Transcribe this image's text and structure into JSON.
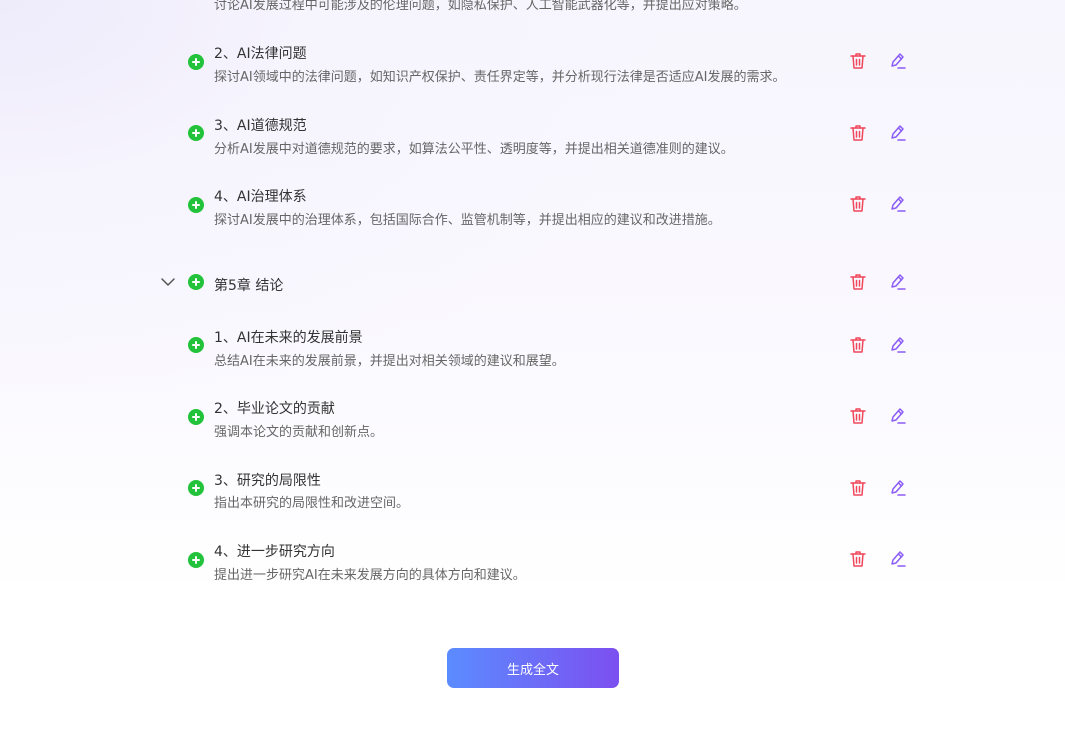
{
  "outline": {
    "partial_desc": "讨论AI发展过程中可能涉及的伦理问题，如隐私保护、人工智能武器化等，并提出应对策略。",
    "sections": [
      {
        "title": "2、AI法律问题",
        "desc": "探讨AI领域中的法律问题，如知识产权保护、责任界定等，并分析现行法律是否适应AI发展的需求。"
      },
      {
        "title": "3、AI道德规范",
        "desc": "分析AI发展中对道德规范的要求，如算法公平性、透明度等，并提出相关道德准则的建议。"
      },
      {
        "title": "4、AI治理体系",
        "desc": "探讨AI发展中的治理体系，包括国际合作、监管机制等，并提出相应的建议和改进措施。"
      }
    ],
    "chapter5": {
      "title": "第5章 结论",
      "sections": [
        {
          "title": "1、AI在未来的发展前景",
          "desc": "总结AI在未来的发展前景，并提出对相关领域的建议和展望。"
        },
        {
          "title": "2、毕业论文的贡献",
          "desc": "强调本论文的贡献和创新点。"
        },
        {
          "title": "3、研究的局限性",
          "desc": "指出本研究的局限性和改进空间。"
        },
        {
          "title": "4、进一步研究方向",
          "desc": "提出进一步研究AI在未来发展方向的具体方向和建议。"
        }
      ]
    }
  },
  "actions": {
    "generate_label": "生成全文"
  },
  "icons": {
    "add": "plus-circle-icon",
    "delete": "trash-icon",
    "edit": "pencil-icon",
    "collapse": "chevron-down-icon"
  },
  "colors": {
    "add_green": "#22c33a",
    "delete_red": "#f0475a",
    "edit_purple": "#8b5cf6",
    "button_gradient_start": "#5b8cff",
    "button_gradient_end": "#7c4ff0"
  }
}
